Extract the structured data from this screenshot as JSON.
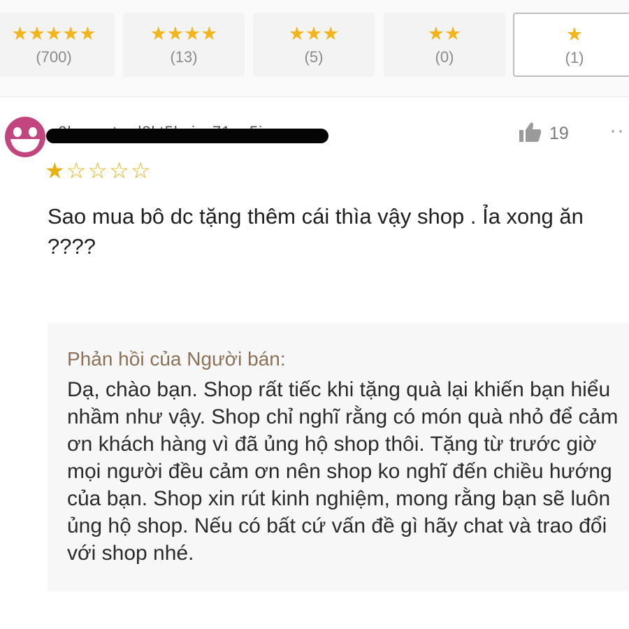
{
  "rating_filters": [
    {
      "stars": "★★★★★",
      "count": "(700)",
      "selected": false
    },
    {
      "stars": "★★★★",
      "count": "(13)",
      "selected": false
    },
    {
      "stars": "★★★",
      "count": "(5)",
      "selected": false
    },
    {
      "stars": "★★",
      "count": "(0)",
      "selected": false
    },
    {
      "stars": "★",
      "count": "(1)",
      "selected": true
    }
  ],
  "review": {
    "username": "e2hqvoptrud8kt5kajvz71ae5i",
    "rating": 1,
    "rating_max": 5,
    "star_filled": "★",
    "star_empty": "☆",
    "like_count": "19",
    "more_label": "··",
    "text": "Sao mua bô dc tặng thêm cái thìa vậy shop . Ỉa xong ăn ????"
  },
  "seller_reply": {
    "title": "Phản hồi của Người bán:",
    "text": "Dạ, chào bạn. Shop rất tiếc khi tặng quà lại khiến bạn hiểu nhầm như vậy. Shop chỉ nghĩ rằng có món quà nhỏ để cảm ơn khách hàng vì đã ủng hộ shop thôi. Tặng từ trước giờ mọi người đều cảm ơn nên shop ko nghĩ đến chiều hướng của bạn. Shop xin rút kinh nghiệm, mong rằng bạn sẽ luôn ủng hộ shop. Nếu có bất cứ vấn đề gì hãy chat và trao đổi với shop nhé."
  },
  "colors": {
    "star": "#f2b51b",
    "avatar": "#c2457f",
    "reply_title": "#8b7257",
    "reply_bg": "#f7f7f7"
  },
  "icons": {
    "avatar": "smiley-face-icon",
    "like": "thumbs-up-icon",
    "more": "more-dots-icon"
  }
}
